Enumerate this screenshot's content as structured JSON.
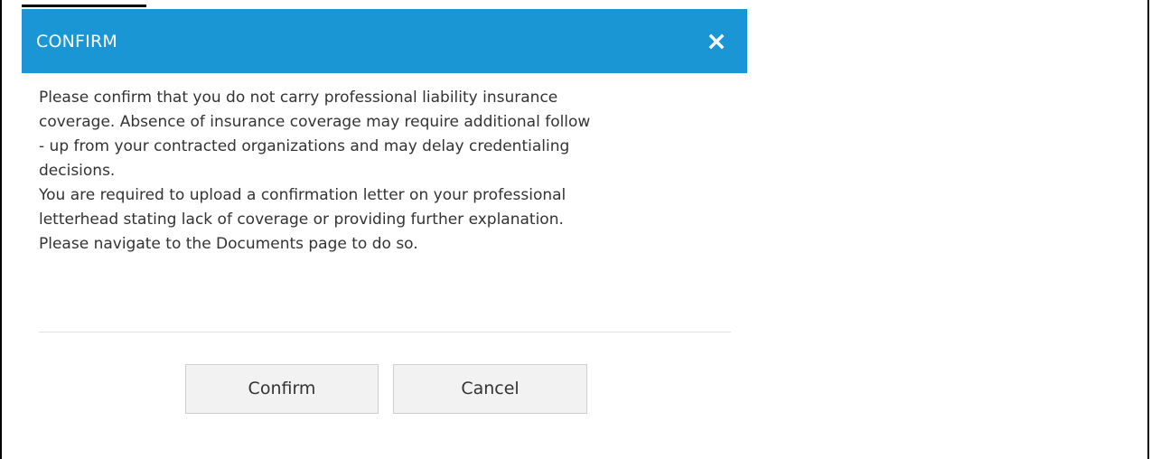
{
  "dialog": {
    "title": "CONFIRM",
    "close_icon": "close-icon",
    "message_lines": [
      "Please confirm that you do not carry professional liability insurance",
      "coverage. Absence of insurance coverage may require additional follow",
      "- up from your contracted organizations and may delay credentialing",
      "decisions.",
      "You are required to upload a confirmation letter on your professional",
      "letterhead stating lack of coverage or providing further explanation.",
      "Please navigate to the Documents page to do so."
    ],
    "buttons": {
      "confirm_label": "Confirm",
      "cancel_label": "Cancel"
    }
  },
  "colors": {
    "header_background": "#1b96d4",
    "header_text": "#ffffff",
    "body_text": "#333333",
    "button_background": "#f2f2f2",
    "button_border": "#cfcfcf"
  }
}
